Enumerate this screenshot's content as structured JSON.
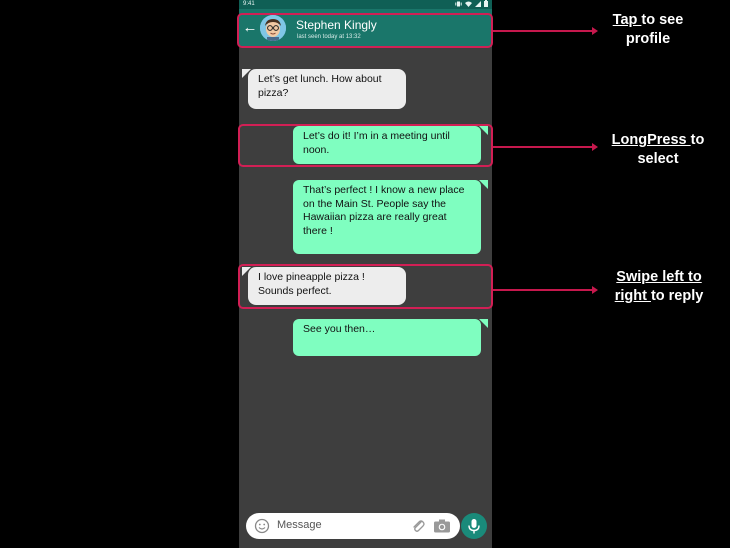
{
  "status_bar": {
    "time": "9:41"
  },
  "header": {
    "contact_name": "Stephen Kingly",
    "last_seen": "last seen today at 13:32"
  },
  "messages": [
    {
      "direction": "received",
      "text": "Let’s get lunch. How about\npizza?"
    },
    {
      "direction": "sent",
      "text": "Let’s do it! I’m in a meeting until\nnoon."
    },
    {
      "direction": "sent",
      "text": "That’s perfect ! I know a new place\non the Main St. People say the\nHawaiian pizza are really great\nthere !"
    },
    {
      "direction": "received",
      "text": "I love pineapple pizza !\nSounds perfect."
    },
    {
      "direction": "sent",
      "text": "See you then…"
    }
  ],
  "input": {
    "placeholder": "Message"
  },
  "annotations": {
    "profile": {
      "emph": "Tap ",
      "rest1": "to see",
      "rest2": "profile"
    },
    "select": {
      "emph": "LongPress ",
      "rest1": "to",
      "rest2": "select"
    },
    "reply": {
      "emph1": "Swipe left to",
      "emph2": "right ",
      "rest": "to reply"
    }
  },
  "colors": {
    "header": "#1a766a",
    "chat_background": "#3e3e3e",
    "sent_bubble": "#7ffec0",
    "received_bubble": "#ededed",
    "highlight": "#d21f55"
  },
  "icons": [
    "back-arrow-icon",
    "avatar",
    "emoji-icon",
    "attach-icon",
    "camera-icon",
    "mic-icon"
  ]
}
